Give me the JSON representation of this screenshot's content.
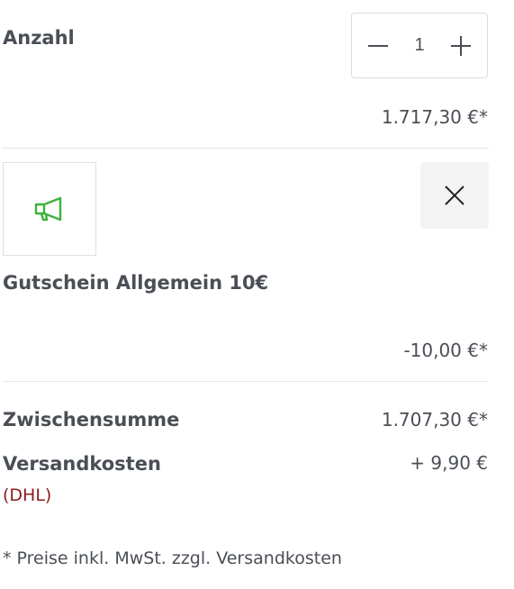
{
  "quantity": {
    "label": "Anzahl",
    "value": "1",
    "decrease_icon": "minus-icon",
    "increase_icon": "plus-icon"
  },
  "product": {
    "price": "1.717,30 €*"
  },
  "voucher": {
    "icon": "megaphone-icon",
    "icon_color": "#3db23a",
    "remove_icon": "close-icon",
    "title": "Gutschein Allgemein 10€",
    "price": "-10,00 €*"
  },
  "summary": {
    "subtotal_label": "Zwischensumme",
    "subtotal_value": "1.707,30 €*",
    "shipping_label": "Versandkosten",
    "shipping_value": "+ 9,90 €",
    "shipping_carrier": "(DHL)",
    "carrier_color": "#8a1c1c"
  },
  "footnote": "* Preise inkl. MwSt. zzgl. Versandkosten"
}
